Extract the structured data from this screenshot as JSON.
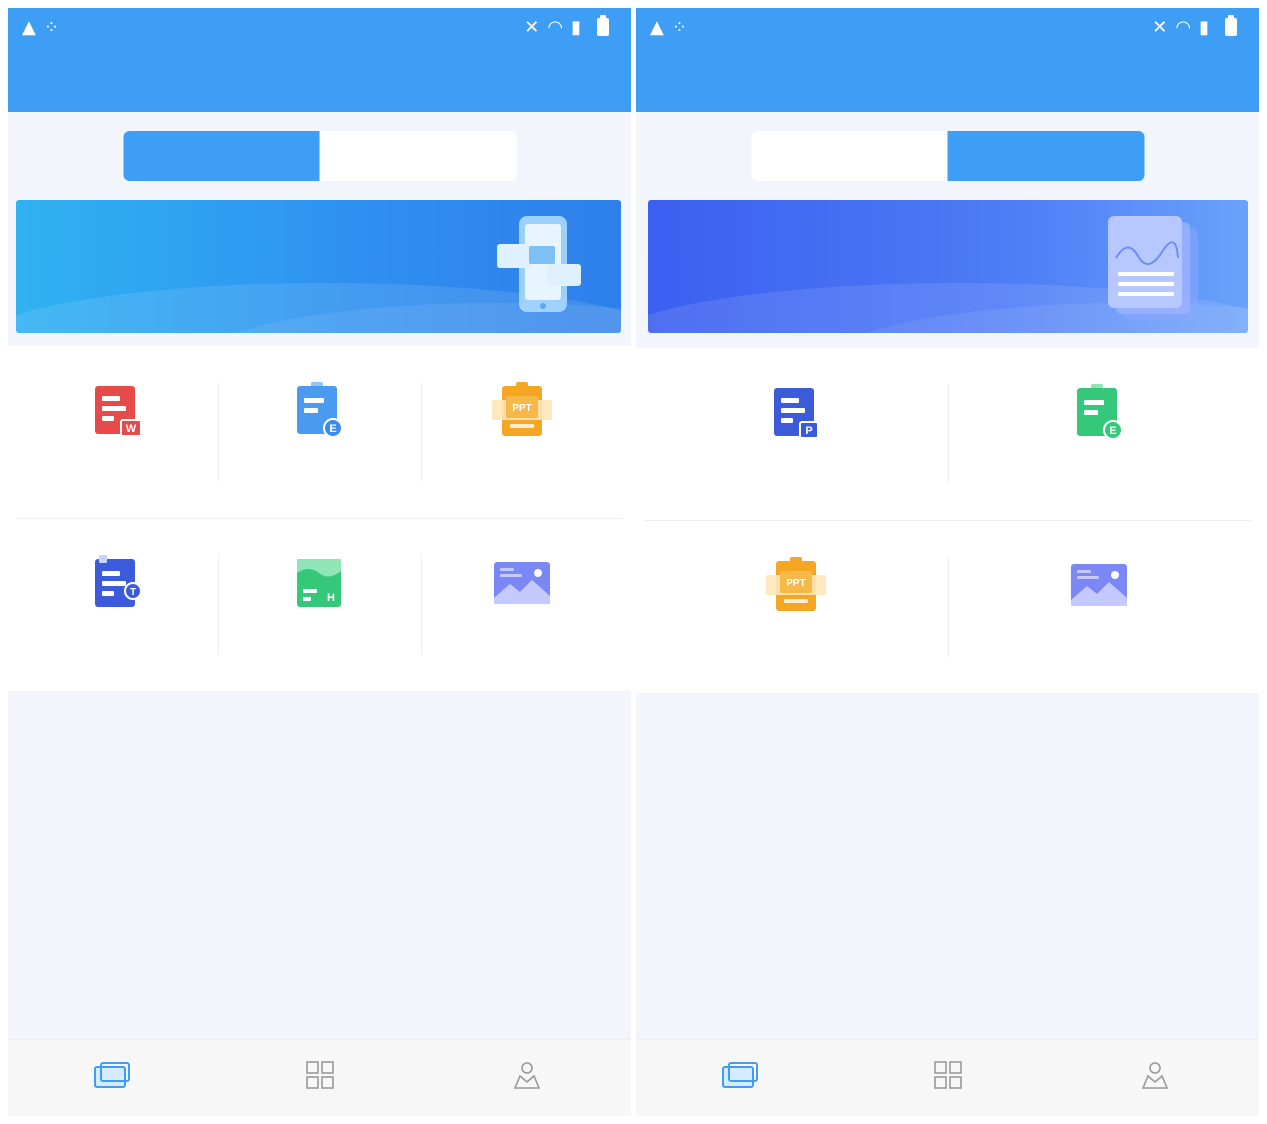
{
  "colors": {
    "primary": "#3e9ef5",
    "background": "#f2f5fb",
    "red": "#e64a4a",
    "blue": "#3d8bf0",
    "orange": "#f5a623",
    "indigo": "#3b5bdb",
    "green": "#35c77a",
    "purple": "#7b87f5"
  },
  "screens": [
    {
      "status": {
        "battery": "",
        "time": ""
      },
      "header": {
        "title": ""
      },
      "tabs": [
        {
          "label": "",
          "active": true
        },
        {
          "label": "",
          "active": false
        }
      ],
      "banner": {
        "title": "",
        "subtitle": ""
      },
      "grid": [
        {
          "label": "",
          "icon": "doc-word-icon"
        },
        {
          "label": "",
          "icon": "doc-excel-icon"
        },
        {
          "label": "",
          "icon": "doc-ppt-icon"
        },
        {
          "label": "",
          "icon": "doc-txt-icon"
        },
        {
          "label": "",
          "icon": "doc-html-icon"
        },
        {
          "label": "",
          "icon": "image-icon"
        }
      ],
      "nav": [
        {
          "label": "",
          "icon": "convert-icon",
          "active": true
        },
        {
          "label": "",
          "icon": "files-icon",
          "active": false
        },
        {
          "label": "",
          "icon": "profile-icon",
          "active": false
        }
      ]
    },
    {
      "status": {
        "battery": "",
        "time": ""
      },
      "header": {
        "title": ""
      },
      "tabs": [
        {
          "label": "",
          "active": false
        },
        {
          "label": "",
          "active": true
        }
      ],
      "banner": {
        "title": "",
        "subtitle": ""
      },
      "grid": [
        {
          "label": "",
          "icon": "doc-word-icon"
        },
        {
          "label": "",
          "icon": "doc-excel-icon"
        },
        {
          "label": "",
          "icon": "doc-ppt-icon"
        },
        {
          "label": "",
          "icon": "image-icon"
        }
      ],
      "nav": [
        {
          "label": "",
          "icon": "convert-icon",
          "active": true
        },
        {
          "label": "",
          "icon": "files-icon",
          "active": false
        },
        {
          "label": "",
          "icon": "profile-icon",
          "active": false
        }
      ]
    }
  ]
}
